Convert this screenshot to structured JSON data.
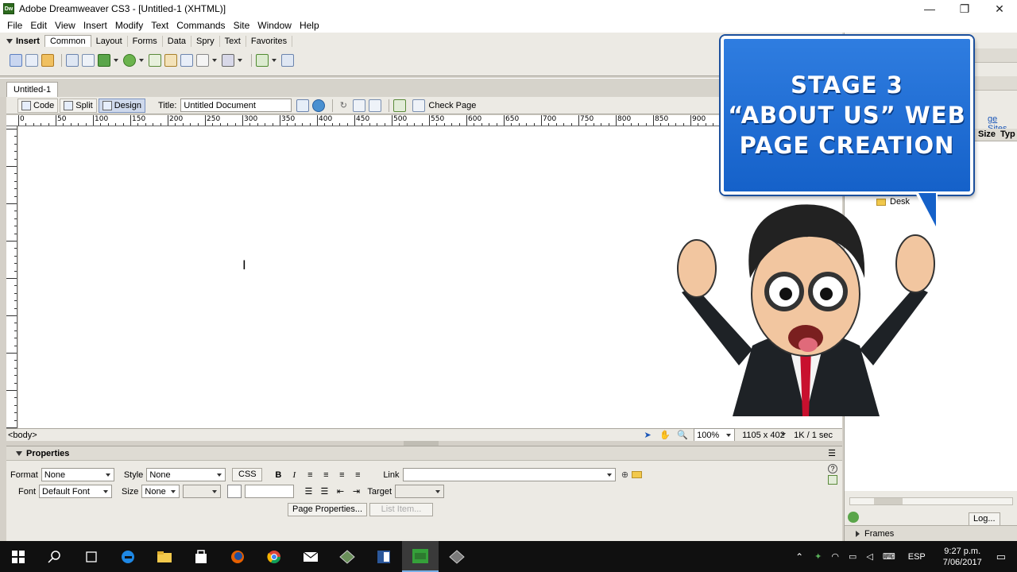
{
  "window": {
    "app_icon": "Dw",
    "title": "Adobe Dreamweaver CS3 - [Untitled-1 (XHTML)]",
    "minimize": "—",
    "restore": "❐",
    "close": "✕"
  },
  "menu": [
    "File",
    "Edit",
    "View",
    "Insert",
    "Modify",
    "Text",
    "Commands",
    "Site",
    "Window",
    "Help"
  ],
  "insert_bar": {
    "title": "Insert",
    "tabs": [
      "Common",
      "Layout",
      "Forms",
      "Data",
      "Spry",
      "Text",
      "Favorites"
    ]
  },
  "document": {
    "tab": "Untitled-1",
    "views": [
      "Code",
      "Split",
      "Design"
    ],
    "title_label": "Title:",
    "title_value": "Untitled Document",
    "check_page": "Check Page"
  },
  "ruler": {
    "labels": [
      "0",
      "50",
      "100",
      "150",
      "200",
      "250",
      "300",
      "350",
      "400",
      "450",
      "500",
      "550",
      "600",
      "650",
      "700",
      "750",
      "800",
      "850",
      "900"
    ]
  },
  "status": {
    "tag": "<body>",
    "zoom": "100%",
    "window_size": "1105 x 402",
    "download": "1K / 1 sec"
  },
  "properties": {
    "title": "Properties",
    "format_label": "Format",
    "format_value": "None",
    "style_label": "Style",
    "style_value": "None",
    "css_button": "CSS",
    "bold": "B",
    "italic": "I",
    "link_label": "Link",
    "font_label": "Font",
    "font_value": "Default Font",
    "size_label": "Size",
    "size_value": "None",
    "target_label": "Target",
    "page_properties": "Page Properties...",
    "list_item": "List Item..."
  },
  "right_panel": {
    "sites_link": "ge Sites",
    "col_size": "Size",
    "col_type": "Typ",
    "tree_item": "Desk",
    "frames": "Frames",
    "log_button": "Log..."
  },
  "overlay": {
    "line1": "STAGE 3",
    "line2": "“ABOUT US” WEB",
    "line3": "PAGE CREATION"
  },
  "taskbar": {
    "language": "ESP",
    "time": "9:27 p.m.",
    "date": "7/06/2017"
  },
  "colors": {
    "bubble_blue": "#1f6fd6",
    "dreamweaver_green": "#2d6b1e"
  }
}
